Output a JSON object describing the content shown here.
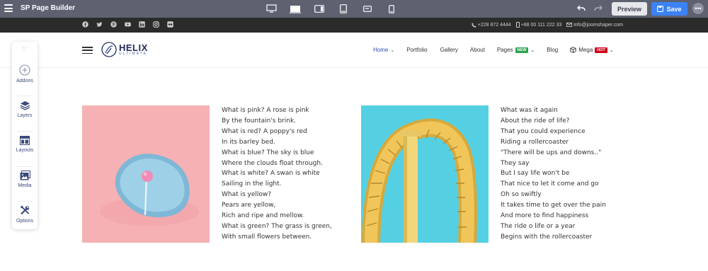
{
  "app": {
    "title": "SP Page Builder",
    "devices": [
      "desktop-icon",
      "laptop-icon",
      "tablet-landscape-icon",
      "tablet-portrait-icon",
      "mobile-landscape-icon",
      "mobile-portrait-icon"
    ],
    "preview_label": "Preview",
    "save_label": "Save",
    "more_label": "•••"
  },
  "social": {
    "icons": [
      "facebook-icon",
      "twitter-icon",
      "pinterest-icon",
      "youtube-icon",
      "linkedin-icon",
      "instagram-icon",
      "flickr-icon"
    ],
    "phone": "+228 872 4444",
    "mobile": "+88 00 111 222 33",
    "email": "info@joomshaper.com"
  },
  "header": {
    "logo_main": "HELIX",
    "logo_sub": "ULTIMATE",
    "nav": [
      {
        "label": "Home",
        "active": true,
        "dropdown": true
      },
      {
        "label": "Portfolio"
      },
      {
        "label": "Gallery"
      },
      {
        "label": "About"
      },
      {
        "label": "Pages",
        "badge": "NEW",
        "badge_color": "#2ea44f",
        "dropdown": true
      },
      {
        "label": "Blog"
      },
      {
        "label": "Mega",
        "badge": "HOT",
        "badge_color": "#d0021b",
        "dropdown": true
      }
    ]
  },
  "sidebar": {
    "handle": "∷",
    "items": [
      {
        "label": "Addons",
        "icon": "plus-circle-icon"
      },
      {
        "label": "Layers",
        "icon": "layers-icon"
      },
      {
        "label": "Layouts",
        "icon": "layout-icon"
      },
      {
        "label": "Media",
        "icon": "media-icon"
      },
      {
        "label": "Options",
        "icon": "tools-icon"
      }
    ]
  },
  "colors": {
    "accent": "#2f49b3",
    "topbar": "#5e6170",
    "save": "#3b82f6"
  },
  "content": {
    "poem1": [
      "What is pink? A rose is pink",
      "By the fountain's brink.",
      "What is red? A poppy's red",
      "In its barley bed.",
      "What is blue? The sky is blue",
      "Where the clouds float through.",
      "What is white? A swan is white",
      "Sailing in the light.",
      "What is yellow?",
      "Pears are yellow,",
      "Rich and ripe and mellow.",
      "What is green? The grass is green,",
      "With small flowers between."
    ],
    "poem2": [
      "What was it again",
      "About the ride of life?",
      "That you could experience",
      "Riding a rollercoaster",
      "\"There will be ups and downs..\"",
      "They say",
      "But I say life won't be",
      "That nice to let it come and go",
      "Oh so swiftly",
      "It takes time to get over the pain",
      "And more to find happiness",
      "The ride o life or a year",
      "Begins with the rollercoaster"
    ]
  }
}
